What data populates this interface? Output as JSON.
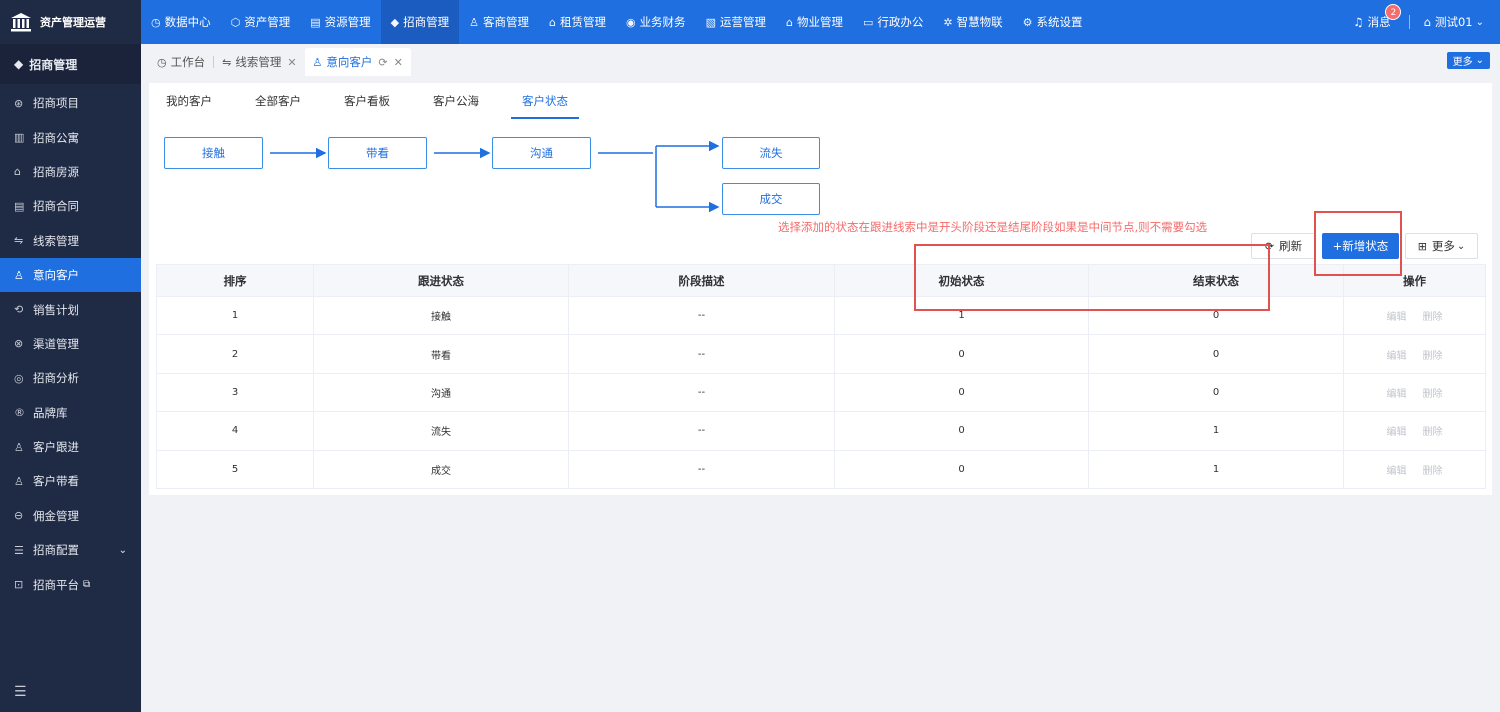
{
  "brand": {
    "title": "资产管理运营"
  },
  "nav": [
    {
      "label": "数据中心",
      "icon": "◷",
      "active": false
    },
    {
      "label": "资产管理",
      "icon": "⬡",
      "active": false
    },
    {
      "label": "资源管理",
      "icon": "▤",
      "active": false
    },
    {
      "label": "招商管理",
      "icon": "◆",
      "active": true
    },
    {
      "label": "客商管理",
      "icon": "♙",
      "active": false
    },
    {
      "label": "租赁管理",
      "icon": "⌂",
      "active": false
    },
    {
      "label": "业务财务",
      "icon": "◉",
      "active": false
    },
    {
      "label": "运营管理",
      "icon": "▧",
      "active": false
    },
    {
      "label": "物业管理",
      "icon": "⌂",
      "active": false
    },
    {
      "label": "行政办公",
      "icon": "▭",
      "active": false
    },
    {
      "label": "智慧物联",
      "icon": "✲",
      "active": false
    },
    {
      "label": "系统设置",
      "icon": "⚙",
      "active": false
    }
  ],
  "topRight": {
    "messages": "消息",
    "badge": "2",
    "user": "测试01"
  },
  "sidebar": {
    "header": "招商管理",
    "items": [
      {
        "label": "招商项目",
        "icon": "⊛"
      },
      {
        "label": "招商公寓",
        "icon": "▥"
      },
      {
        "label": "招商房源",
        "icon": "⌂"
      },
      {
        "label": "招商合同",
        "icon": "▤"
      },
      {
        "label": "线索管理",
        "icon": "⇋"
      },
      {
        "label": "意向客户",
        "icon": "♙",
        "active": true
      },
      {
        "label": "销售计划",
        "icon": "⟲"
      },
      {
        "label": "渠道管理",
        "icon": "⊗"
      },
      {
        "label": "招商分析",
        "icon": "◎"
      },
      {
        "label": "品牌库",
        "icon": "®"
      },
      {
        "label": "客户跟进",
        "icon": "♙"
      },
      {
        "label": "客户带看",
        "icon": "♙"
      },
      {
        "label": "佣金管理",
        "icon": "⊖"
      },
      {
        "label": "招商配置",
        "icon": "☰",
        "chevron": "⌄"
      },
      {
        "label": "招商平台",
        "icon": "⊡",
        "external": "⧉"
      }
    ],
    "collapse_icon": "☰"
  },
  "pageTabs": [
    {
      "label": "工作台",
      "icon": "◷",
      "closable": false
    },
    {
      "label": "线索管理",
      "icon": "⇋",
      "closable": true
    },
    {
      "label": "意向客户",
      "icon": "♙",
      "closable": true,
      "active": true
    }
  ],
  "moreButton": "更多",
  "subTabs": [
    {
      "label": "我的客户"
    },
    {
      "label": "全部客户"
    },
    {
      "label": "客户看板"
    },
    {
      "label": "客户公海"
    },
    {
      "label": "客户状态",
      "active": true
    }
  ],
  "flow": {
    "contact": "接触",
    "visit": "带看",
    "communicate": "沟通",
    "lost": "流失",
    "deal": "成交"
  },
  "note": "选择添加的状态在跟进线索中是开头阶段还是结尾阶段如果是中间节点,则不需要勾选",
  "toolbar": {
    "refresh": "刷新",
    "add": "+新增状态",
    "more": "更多"
  },
  "table": {
    "columns": [
      "排序",
      "跟进状态",
      "阶段描述",
      "初始状态",
      "结束状态",
      "操作"
    ],
    "rows": [
      {
        "order": "1",
        "status": "接触",
        "desc": "--",
        "initial": "1",
        "final": "0"
      },
      {
        "order": "2",
        "status": "带看",
        "desc": "--",
        "initial": "0",
        "final": "0"
      },
      {
        "order": "3",
        "status": "沟通",
        "desc": "--",
        "initial": "0",
        "final": "0"
      },
      {
        "order": "4",
        "status": "流失",
        "desc": "--",
        "initial": "0",
        "final": "1"
      },
      {
        "order": "5",
        "status": "成交",
        "desc": "--",
        "initial": "0",
        "final": "1"
      }
    ],
    "edit": "编辑",
    "delete": "删除"
  }
}
